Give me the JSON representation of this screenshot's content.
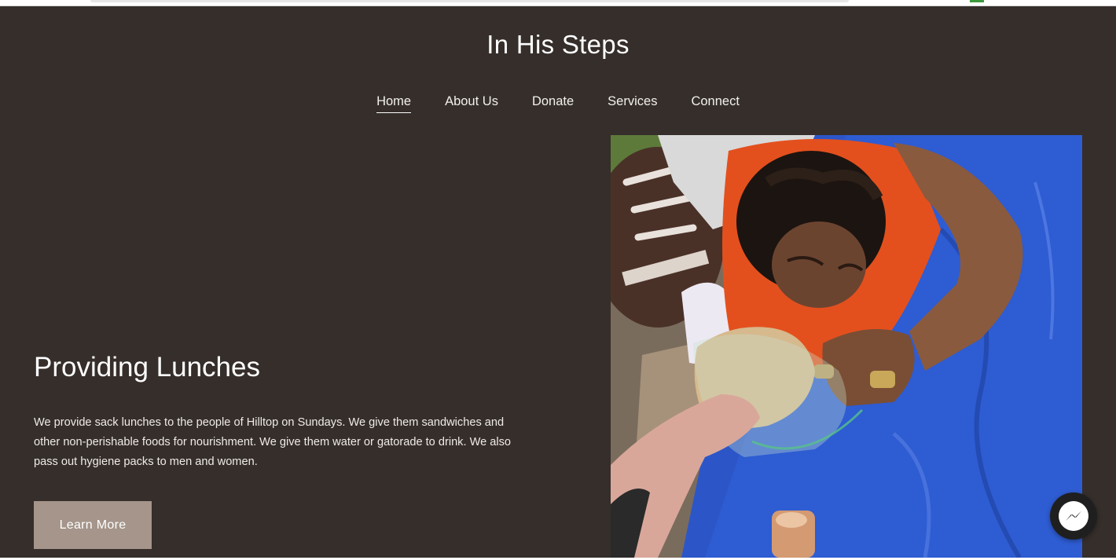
{
  "site": {
    "title": "In His Steps"
  },
  "nav": {
    "items": [
      {
        "label": "Home",
        "active": true
      },
      {
        "label": "About Us",
        "active": false
      },
      {
        "label": "Donate",
        "active": false
      },
      {
        "label": "Services",
        "active": false
      },
      {
        "label": "Connect",
        "active": false
      }
    ]
  },
  "hero": {
    "heading": "Providing Lunches",
    "body": "We provide sack lunches to the people of Hilltop on Sundays. We give them sandwiches and other non-perishable foods for nourishment. We give them water or gatorade to drink. We also pass out hygiene packs to men and women.",
    "button_label": "Learn More",
    "image_icon": "photo-lunch-handout"
  },
  "chat": {
    "icon": "messenger-icon"
  },
  "colors": {
    "background": "#352e2b",
    "button": "#a5958a",
    "text": "#ffffff",
    "tarp": "#2c56c8",
    "shirt": "#e3501e"
  }
}
